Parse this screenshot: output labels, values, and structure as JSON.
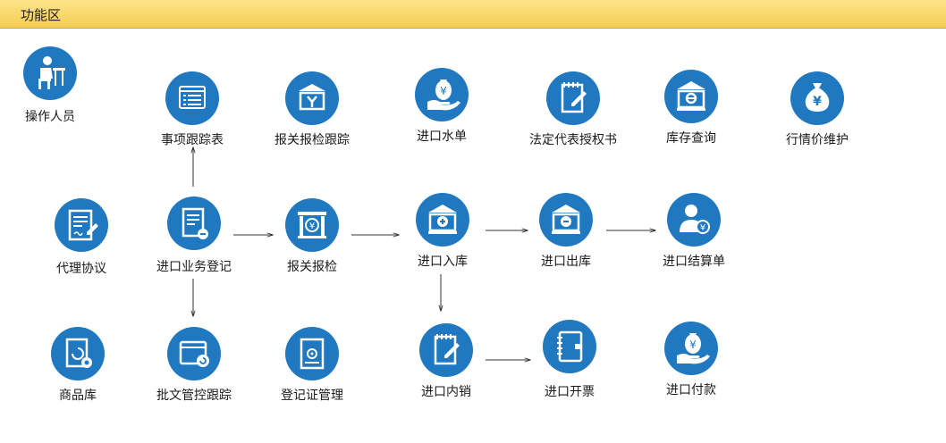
{
  "header": {
    "title": "功能区"
  },
  "nodes": {
    "operator": {
      "label": "操作人员",
      "icon": "worker-at-desk-icon"
    },
    "task_tracking": {
      "label": "事项跟踪表",
      "icon": "browser-list-icon"
    },
    "customs_tracking": {
      "label": "报关报检跟踪",
      "icon": "building-tools-icon"
    },
    "import_water": {
      "label": "进口水单",
      "icon": "money-hand-icon"
    },
    "power_of_attorney": {
      "label": "法定代表授权书",
      "icon": "notepad-pen-icon"
    },
    "inventory_query": {
      "label": "库存查询",
      "icon": "warehouse-search-icon"
    },
    "price_maintenance": {
      "label": "行情价维护",
      "icon": "money-bag-icon"
    },
    "agency_agreement": {
      "label": "代理协议",
      "icon": "document-sign-icon"
    },
    "import_registration": {
      "label": "进口业务登记",
      "icon": "document-remove-icon"
    },
    "customs_inspection": {
      "label": "报关报检",
      "icon": "building-yen-icon"
    },
    "import_inbound": {
      "label": "进口入库",
      "icon": "warehouse-add-icon"
    },
    "import_outbound": {
      "label": "进口出库",
      "icon": "warehouse-remove-icon"
    },
    "import_settlement": {
      "label": "进口结算单",
      "icon": "user-yen-icon"
    },
    "product_library": {
      "label": "商品库",
      "icon": "document-gear-icon"
    },
    "approval_tracking": {
      "label": "批文管控跟踪",
      "icon": "window-refresh-icon"
    },
    "certificate_management": {
      "label": "登记证管理",
      "icon": "certificate-icon"
    },
    "import_domestic_sales": {
      "label": "进口内销",
      "icon": "notepad-pen-icon"
    },
    "import_invoice": {
      "label": "进口开票",
      "icon": "ledger-book-icon"
    },
    "import_payment": {
      "label": "进口付款",
      "icon": "money-hand-icon"
    }
  },
  "colors": {
    "circle": "#1f78c0",
    "header": "#f6cd52",
    "arrow": "#333333"
  }
}
